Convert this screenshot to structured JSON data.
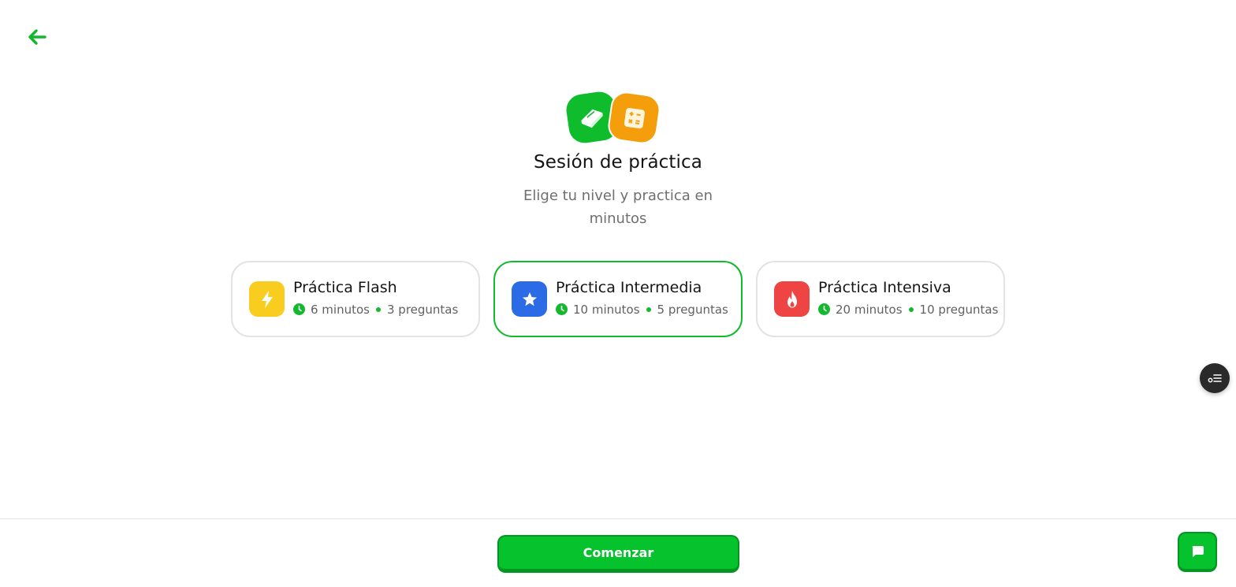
{
  "header": {
    "back_icon": "arrow-left-icon"
  },
  "hero": {
    "icons": [
      "book-icon",
      "calculator-icon"
    ],
    "title": "Sesión de práctica",
    "subtitle": "Elige tu nivel y practica en minutos"
  },
  "options": [
    {
      "title": "Práctica Flash",
      "icon": "lightning-icon",
      "icon_color": "#f9cd1f",
      "minutes": "6 minutos",
      "questions": "3 preguntas",
      "selected": false
    },
    {
      "title": "Práctica Intermedia",
      "icon": "star-icon",
      "icon_color": "#2c6be6",
      "minutes": "10 minutos",
      "questions": "5 preguntas",
      "selected": true
    },
    {
      "title": "Práctica Intensiva",
      "icon": "flame-icon",
      "icon_color": "#ef4444",
      "minutes": "20 minutos",
      "questions": "10 preguntas",
      "selected": false
    }
  ],
  "footer": {
    "start_label": "Comenzar",
    "chat_icon": "chat-icon"
  },
  "floating": {
    "icon": "settings-list-icon"
  },
  "colors": {
    "accent": "#05c22d",
    "book": "#0fbd2c",
    "calculator": "#f59e0b"
  }
}
